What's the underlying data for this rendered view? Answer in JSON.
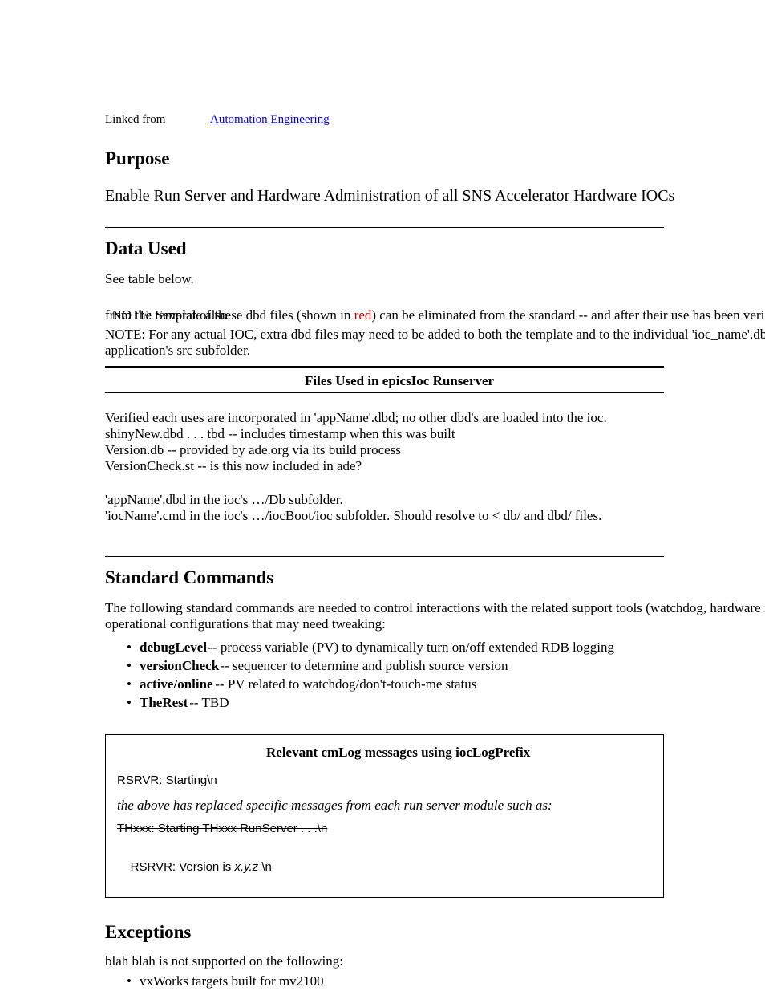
{
  "header": {
    "linked_from": "Linked from ",
    "link_text": "Automation Engineering",
    "main_title": "Purpose",
    "subtitle": "Enable Run Server and Hardware Administration of all SNS Accelerator Hardware IOCs"
  },
  "section1": {
    "heading": "Data Used",
    "line1": "See table below.",
    "note_a": "NOTE: Several of these dbd files (shown in ",
    "note_b": "red",
    "note_c": ") can be eliminated from the standard -- and after their use has been verified -- ",
    "note_d": "from the template also.",
    "line3a": "NOTE: For any actual IOC, extra dbd files may need to be added to both the template and to the individual 'ioc_name'.dbd file in the ",
    "line3b": "application's src subfolder."
  },
  "table": {
    "header": "Files Used in epicsIoc Runserver"
  },
  "section2": {
    "heading": "Standard Commands",
    "line1a": "The following standard commands are needed to control interactions with the related support tools (watchdog, hardware reboot) and with the ",
    "line1b": "operational configurations that may need tweaking:",
    "list": [
      {
        "term": "debugLevel",
        "desc": " -- process variable (PV) to dynamically turn on/off extended RDB logging"
      },
      {
        "term": "versionCheck",
        "desc": " -- sequencer to determine and publish source version"
      },
      {
        "term": "active/online",
        "desc": " -- PV related to watchdog/don't-touch-me status"
      },
      {
        "term": "TheRest",
        "desc": " -- TBD"
      }
    ]
  },
  "codebox": {
    "header": "Relevant cmLog messages using iocLogPrefix",
    "line1": "RSRVR: Starting\\n",
    "line2": "the above has replaced specific messages from each run server module such as:",
    "line3": "THxxx: Starting THxxx RunServer . . .\\n",
    "line4_a": "RSRVR: Version is ",
    "line4_b": "x.y.z",
    "line4_c": " \\n"
  },
  "section3": {
    "heading": "Exceptions",
    "line1": "blah blah is not supported on the following:",
    "bullet": "vxWorks targets built for mv2100"
  }
}
